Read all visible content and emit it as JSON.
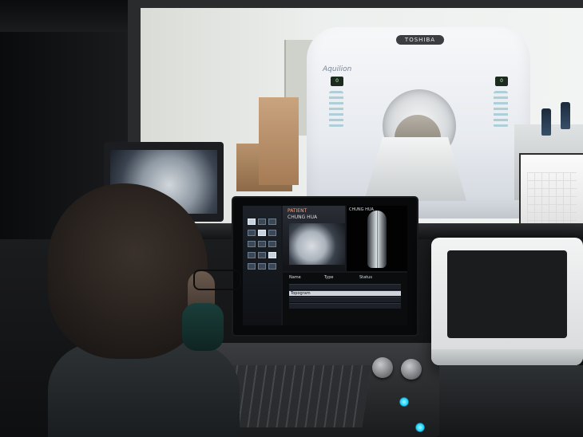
{
  "scene": {
    "description_tags": [
      "ct-scanner-room",
      "control-console"
    ],
    "scanner": {
      "brand": "TOSHIBA",
      "model": "Aquilion",
      "panel_left": "0",
      "panel_right": "0"
    },
    "console_screen": {
      "header_left": "PATIENT",
      "header_right": "CHUNG HUA",
      "info_lines": [
        "CHUNG HUA",
        "CT",
        "Helical",
        "120kV"
      ],
      "table_header": [
        "Name",
        "Type",
        "Status"
      ],
      "table_rows": [
        [
          "",
          "",
          ""
        ],
        [
          "Topogram",
          "",
          ""
        ],
        [
          "",
          "",
          ""
        ],
        [
          "",
          "",
          ""
        ]
      ],
      "footer_left": "",
      "footer_right": ""
    }
  },
  "colors": {
    "accent": "#15d2ff",
    "screen_bg": "#15181c"
  }
}
